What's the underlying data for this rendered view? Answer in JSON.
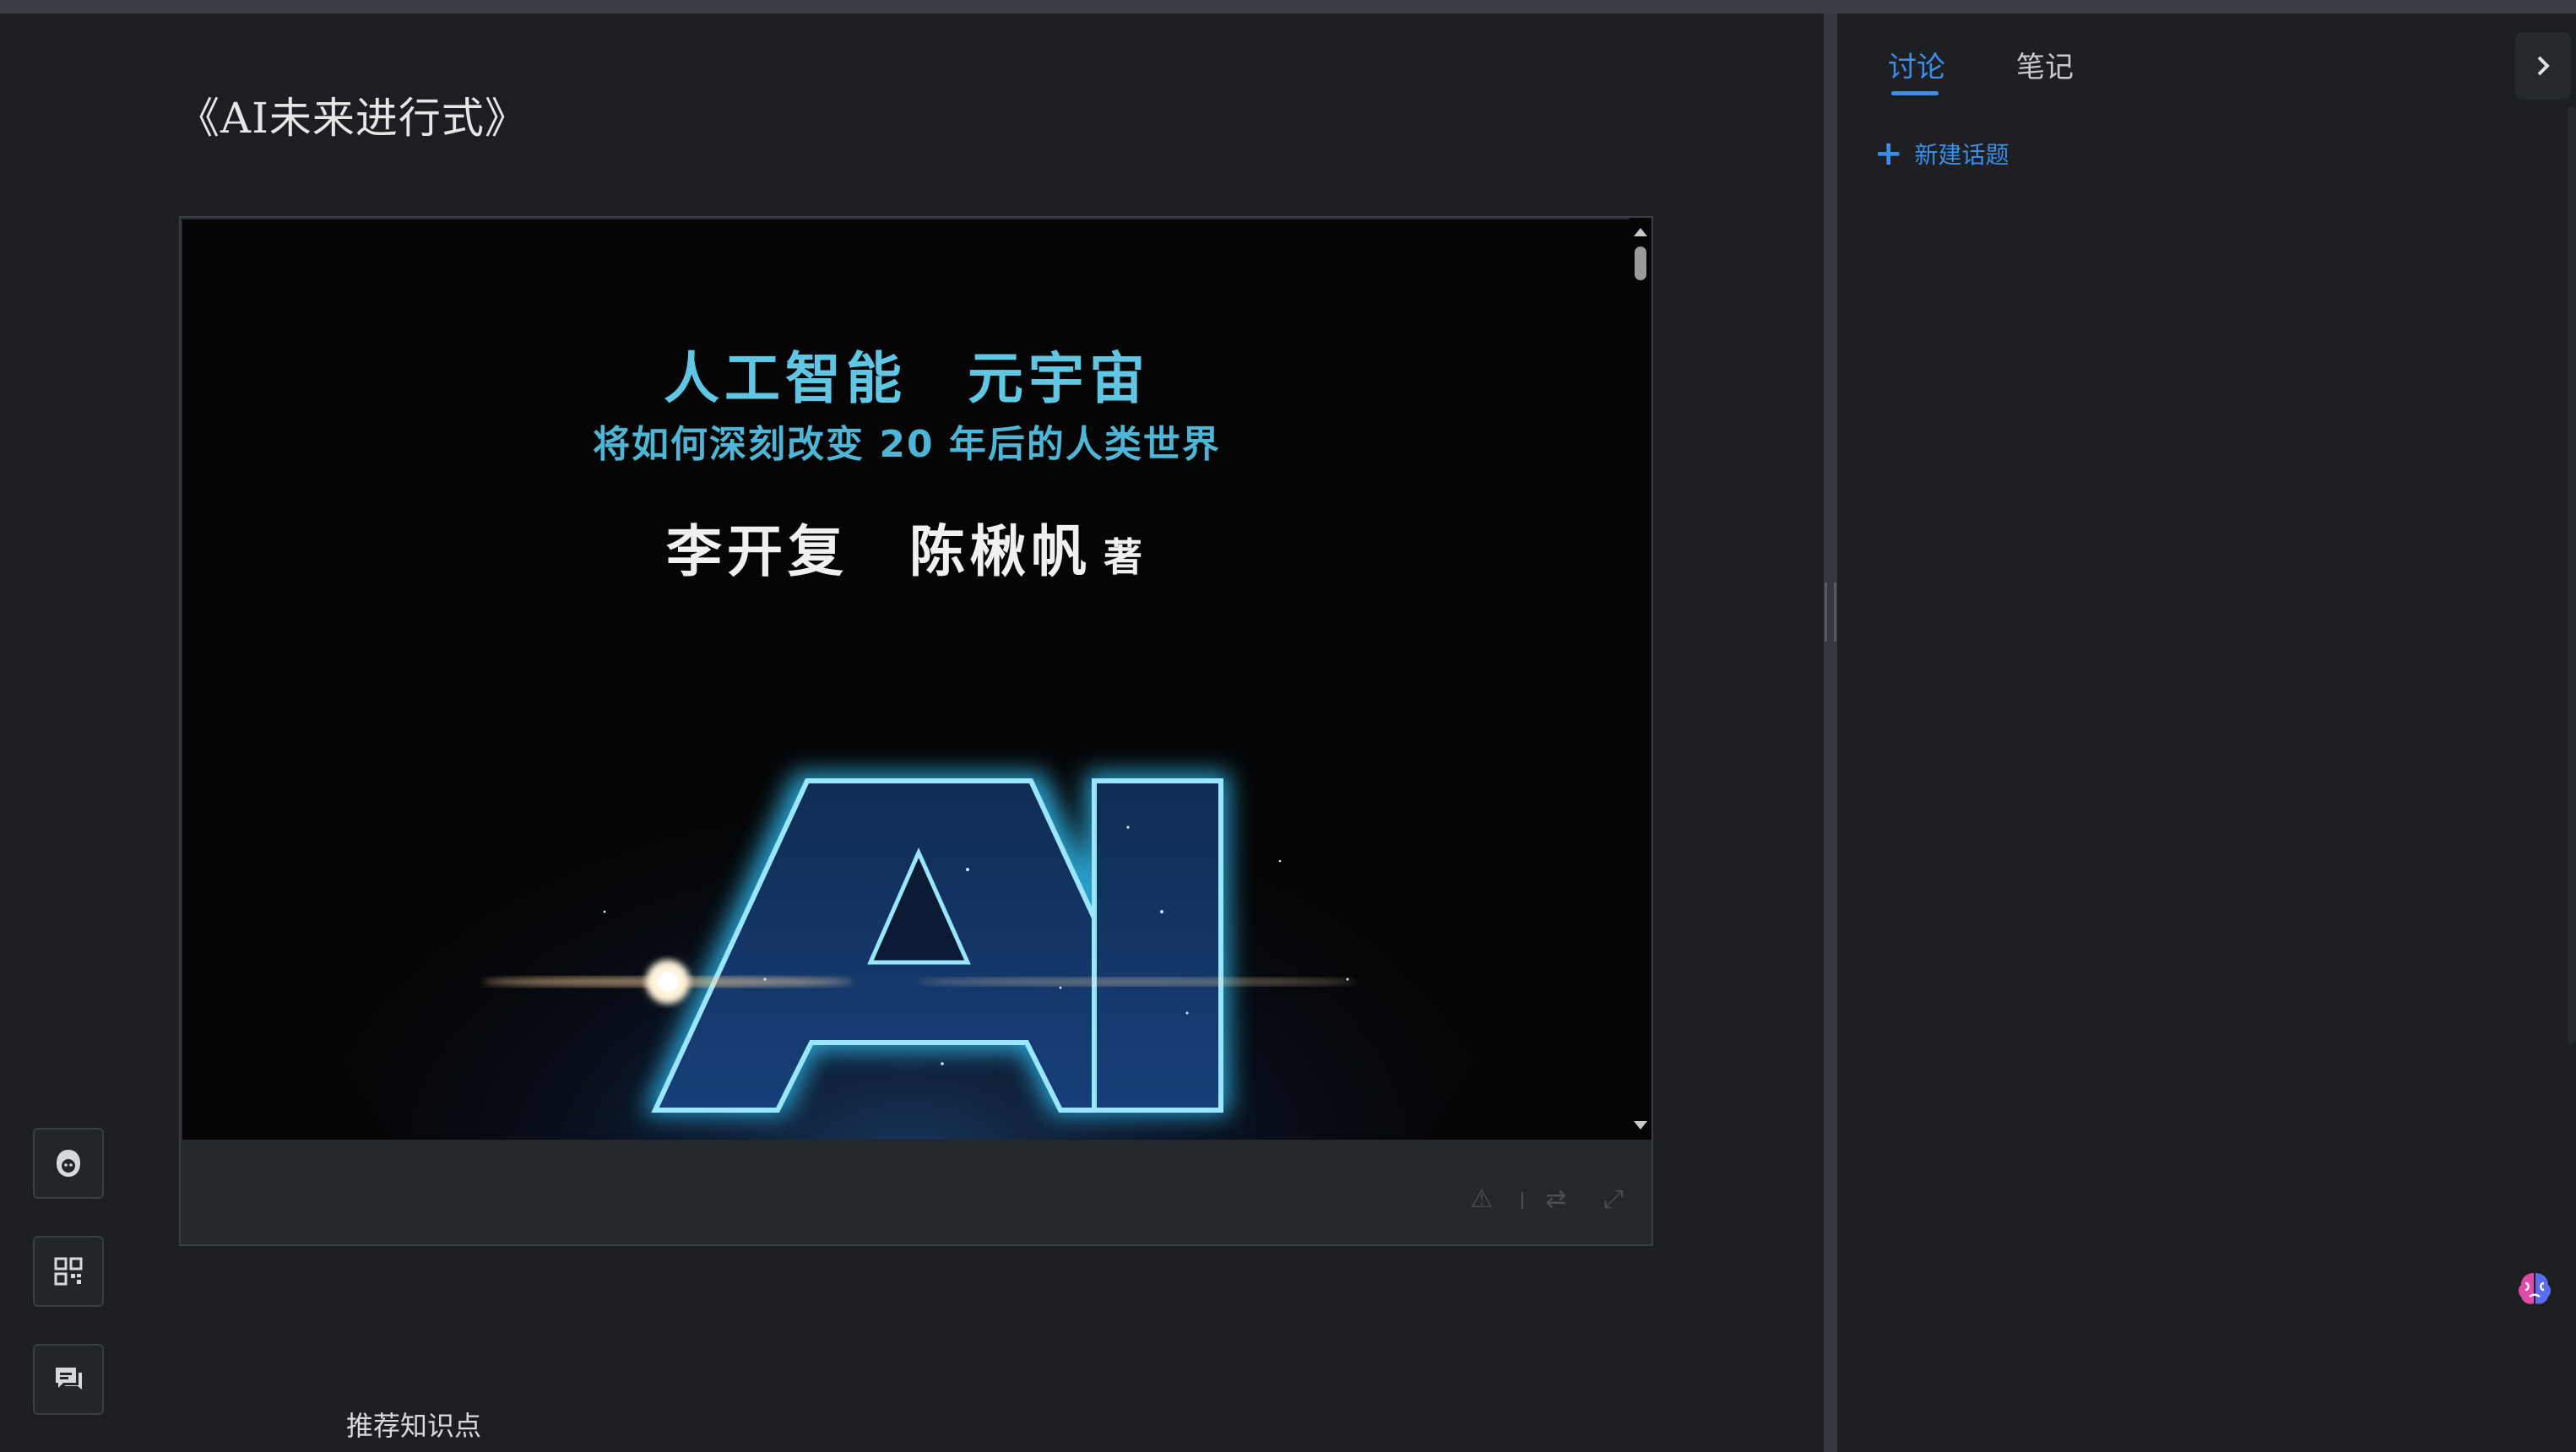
{
  "document": {
    "title": "《AI未来进行式》"
  },
  "cover": {
    "line1": "人工智能　元宇宙",
    "line2": "将如何深刻改变 20 年后的人类世界",
    "authors": "李开复　陈楸帆",
    "author_suffix": "著",
    "big_text": "AI"
  },
  "left_rail": {
    "buttons": [
      {
        "icon": "bot-icon"
      },
      {
        "icon": "qrcode-icon"
      },
      {
        "icon": "chat-icon"
      }
    ]
  },
  "recommend_label": "推荐知识点",
  "panel": {
    "tabs": [
      {
        "label": "讨论",
        "active": true
      },
      {
        "label": "笔记",
        "active": false
      }
    ],
    "new_topic_label": "新建话题"
  },
  "colors": {
    "accent": "#3c8ee8",
    "cover_cyan": "#5fc7e3",
    "background": "#1c1e22"
  }
}
